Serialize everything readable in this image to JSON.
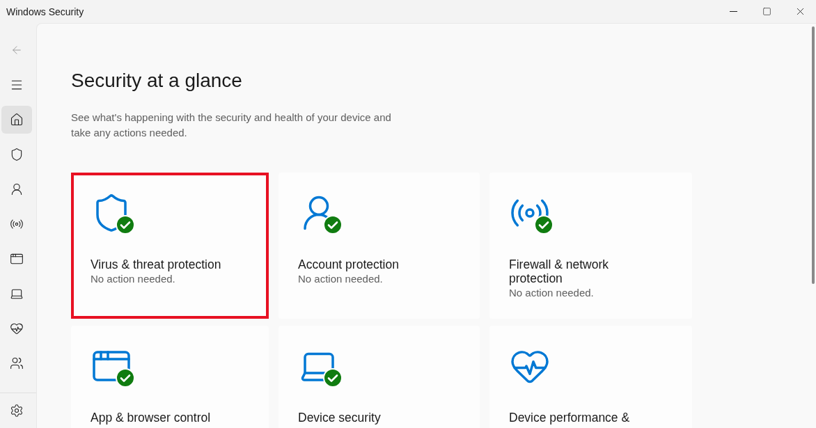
{
  "window": {
    "title": "Windows Security"
  },
  "sidebar": {
    "back_disabled": true,
    "items": [
      {
        "kind": "home",
        "selected": true
      },
      {
        "kind": "shield",
        "selected": false
      },
      {
        "kind": "account",
        "selected": false
      },
      {
        "kind": "network",
        "selected": false
      },
      {
        "kind": "app",
        "selected": false
      },
      {
        "kind": "device",
        "selected": false
      },
      {
        "kind": "health",
        "selected": false
      },
      {
        "kind": "family",
        "selected": false
      }
    ]
  },
  "page": {
    "title": "Security at a glance",
    "subtitle": "See what's happening with the security and health of your device and take any actions needed."
  },
  "cards": [
    {
      "kind": "shield",
      "title": "Virus & threat protection",
      "status": "No action needed.",
      "ok": true,
      "highlighted": true
    },
    {
      "kind": "account",
      "title": "Account protection",
      "status": "No action needed.",
      "ok": true,
      "highlighted": false
    },
    {
      "kind": "network",
      "title": "Firewall & network protection",
      "status": "No action needed.",
      "ok": true,
      "highlighted": false
    },
    {
      "kind": "app",
      "title": "App & browser control",
      "ok": true,
      "highlighted": false
    },
    {
      "kind": "device",
      "title": "Device security",
      "ok": true,
      "highlighted": false
    },
    {
      "kind": "health",
      "title": "Device performance &",
      "ok": false,
      "highlighted": false
    }
  ]
}
